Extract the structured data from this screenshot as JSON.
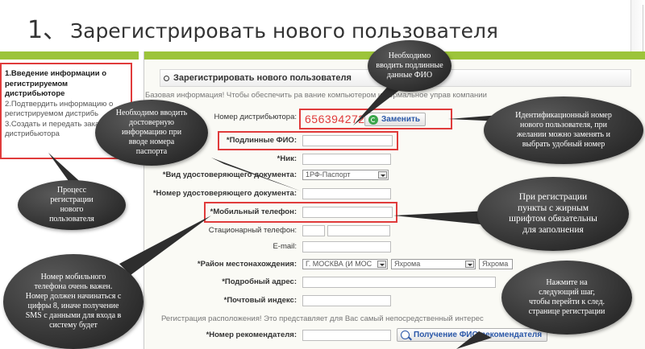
{
  "slide": {
    "number": "1、",
    "title": "Зарегистрировать нового пользователя"
  },
  "sidebar": {
    "steps": [
      "1.Введение информации о регистрируемом дистрибьюторе",
      "2.Подтвердить информацию о регистрируемом дистрибь",
      "3.Создать и передать зака",
      "дистрибьютора"
    ]
  },
  "form": {
    "header": "Зарегистрировать нового пользователя",
    "info_line": "Базовая информация! Чтобы обеспечить ра              вание компьютером и нормальное управ                                  компании",
    "distributor_label": "Номер дистрибьютора:",
    "distributor_number": "656394272",
    "change_button": "Заменить",
    "fields": {
      "fio": "*Подлинные ФИО:",
      "nick": "*Ник:",
      "doc_type": "*Вид удостоверяющего документа:",
      "doc_type_value": "1РФ-Паспорт",
      "doc_number": "*Номер удостоверяющего документа:",
      "mobile": "*Мобильный телефон:",
      "landline": "Стационарный телефон:",
      "email": "E-mail:",
      "region": "*Район местонахождения:",
      "region_city": "Г. МОСКВА (И МОС",
      "region_district": "Яхрома",
      "region_locality": "Яхрома",
      "address": "*Подробный адрес:",
      "postcode": "*Почтовый индекс:",
      "recommender": "*Номер рекомендателя:",
      "recommender_button": "Получение ФИО рекомендателя"
    },
    "info_line2": "Регистрация расположения! Это представляет для Вас самый непосредственный интерес"
  },
  "callouts": {
    "fio_required": "Необходимо вводить подлинные данные ФИО",
    "id_number": "Идентификационный номер нового пользователя, при желании можно заменять и выбрать удобный номер",
    "accurate_info": "Необходимо вводить достоверную информацию при вводе номера паспорта",
    "process": "Процесс регистрации нового пользователя",
    "bold_fields": "При регистрации пункты с жирным шрифтом обязательны для заполнения",
    "mobile_important": "Номер мобильного телефона очень важен. Номер должен начинаться с цифры 8, иначе получение SMS с данными для входа в систему будет",
    "next_step": "Нажмите на следующий шаг, чтобы перейти к след. странице регистрации"
  },
  "colors": {
    "accent_green": "#9cc43a",
    "highlight_red": "#e03b3b",
    "bubble_dark": "#2b2b2b"
  }
}
